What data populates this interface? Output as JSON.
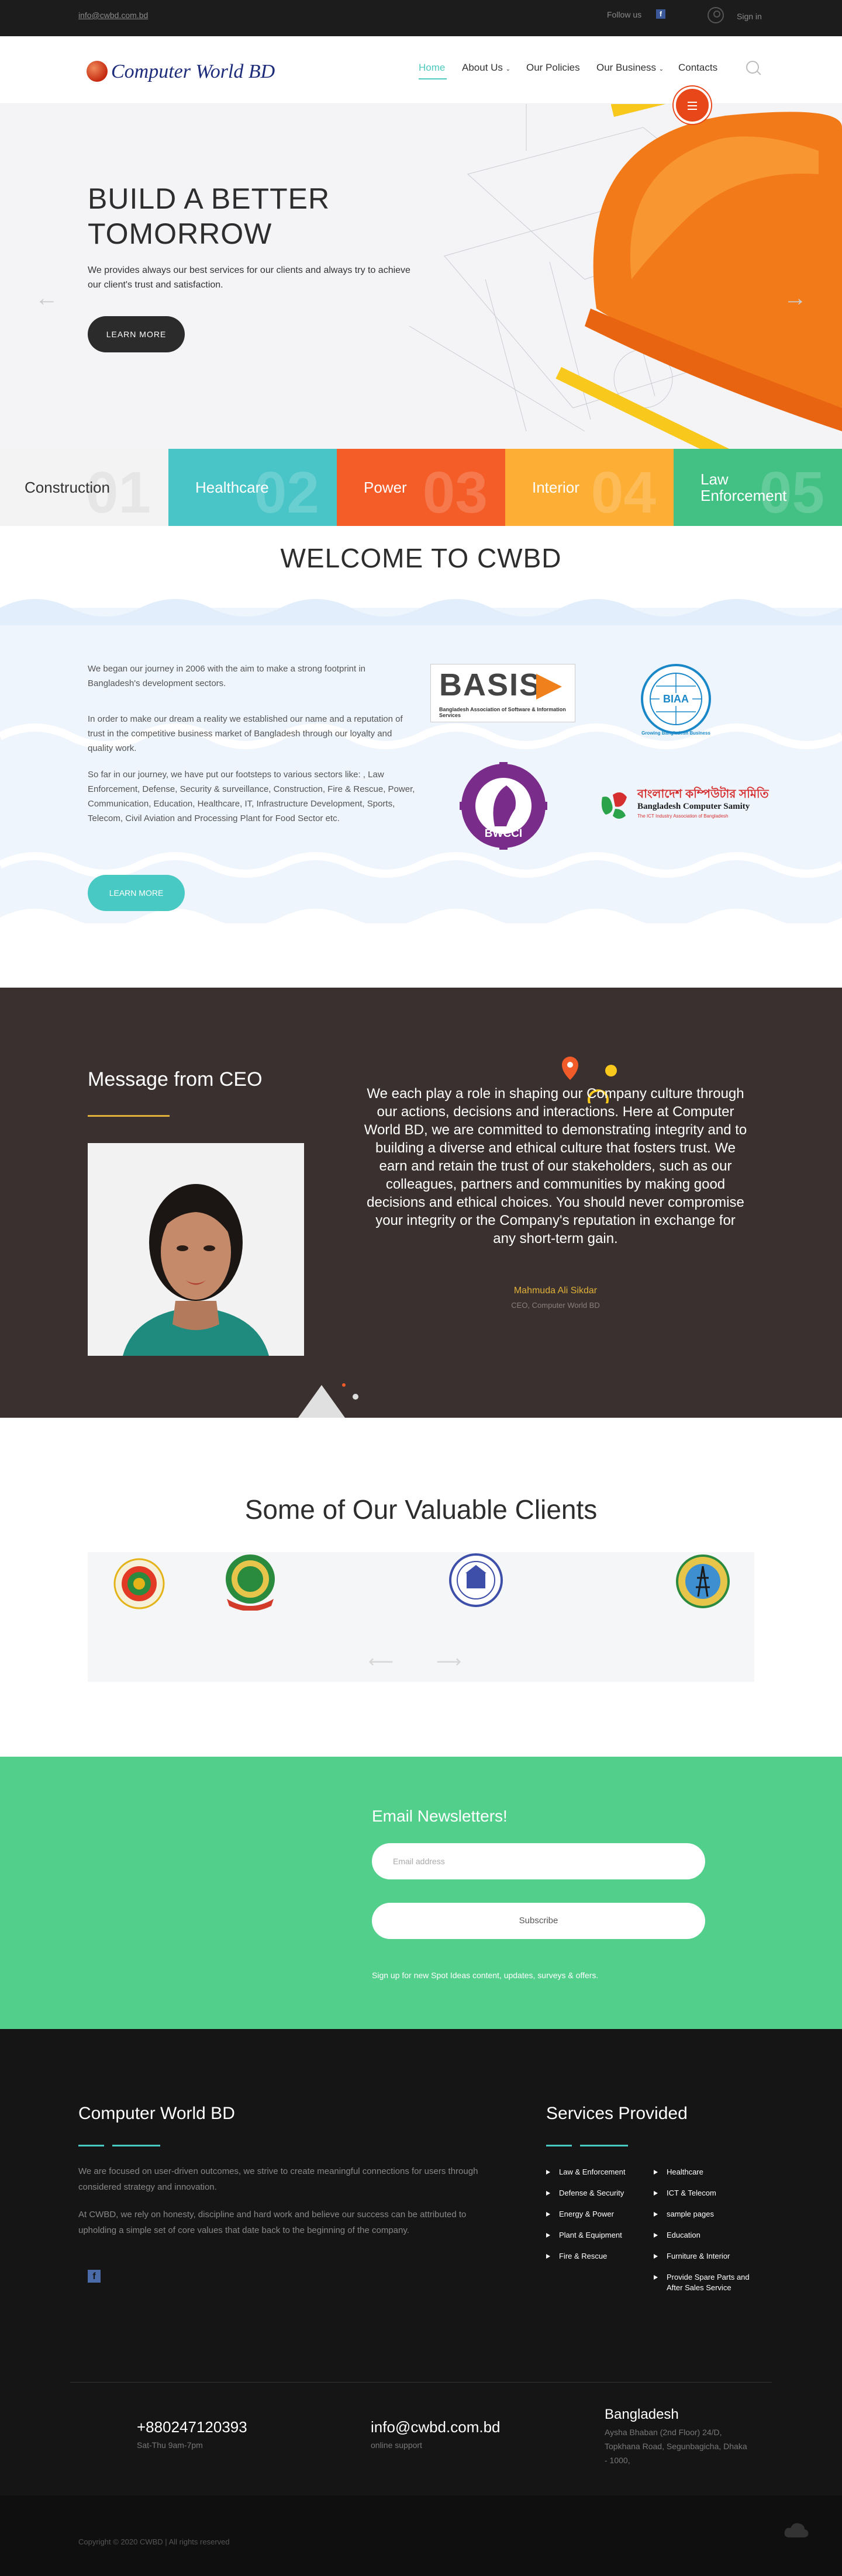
{
  "topbar": {
    "email": "info@cwbd.com.bd",
    "follow_label": "Follow us",
    "facebook_icon": "facebook-icon",
    "signin": "Sign in"
  },
  "header": {
    "logo_text": "Computer World BD",
    "nav": [
      {
        "label": "Home"
      },
      {
        "label": "About Us"
      },
      {
        "label": "Our Policies"
      },
      {
        "label": "Our Business"
      },
      {
        "label": "Contacts"
      }
    ]
  },
  "hero": {
    "heading": "BUILD A BETTER TOMORROW",
    "subtitle": "We provides always our best services for our clients and always try to achieve our client's trust and satisfaction.",
    "cta": "LEARN MORE"
  },
  "tabs": [
    {
      "label": "Construction",
      "num": "01",
      "color": "#f3f3f3"
    },
    {
      "label": "Healthcare",
      "num": "02",
      "color": "#49c5c7"
    },
    {
      "label": "Power",
      "num": "03",
      "color": "#f45c28"
    },
    {
      "label": "Interior",
      "num": "04",
      "color": "#fdae34"
    },
    {
      "label": "Law Enforcement",
      "num": "05",
      "color": "#43c184"
    }
  ],
  "welcome": {
    "title": "WELCOME TO CWBD",
    "p1": "We began our journey in 2006 with the aim to make a strong footprint in Bangladesh's development sectors.",
    "p2": "In order to make our dream a reality we established our name and a reputation of trust in the competitive business market of Bangladesh through our loyalty and quality work.",
    "p3": "So far in our journey, we have put our footsteps to various sectors like: , Law Enforcement, Defense, Security & surveillance, Construction, Fire & Rescue, Power, Communication, Education, Healthcare, IT, Infrastructure Development, Sports, Telecom, Civil Aviation and Processing Plant for Food Sector etc.",
    "cta": "LEARN MORE",
    "badges": {
      "basis_title": "BASIS",
      "basis_sub": "Bangladesh Association of Software & Information Services",
      "biaa": "BIAA",
      "biaa_sub": "Growing Bangladesh Business",
      "bwcci": "BWCCI",
      "bcs_bn": "বাংলাদেশ কম্পিউটার সমিতি",
      "bcs_en": "Bangladesh Computer Samity",
      "bcs_tag": "The ICT Industry Association of Bangladesh"
    }
  },
  "ceo": {
    "title": "Message from CEO",
    "message": "We each play a role in shaping our Company culture through our actions, decisions and interactions. Here at Computer World BD, we are committed to demonstrating integrity and to building a diverse and ethical culture that fosters trust. We earn and retain the trust of our stakeholders, such as our colleagues, partners and communities by making good decisions and ethical choices. You should never compromise your integrity or the Company's reputation in exchange for any short-term gain.",
    "name": "Mahmuda Ali Sikdar",
    "role": "CEO, Computer World BD"
  },
  "clients": {
    "title": "Some of Our Valuable Clients"
  },
  "newsletter": {
    "title": "Email Newsletters!",
    "placeholder": "Email address",
    "button": "Subscribe",
    "note": "Sign up for new Spot Ideas content, updates, surveys & offers."
  },
  "footer": {
    "company_title": "Computer World BD",
    "p1": "We are focused on user-driven outcomes, we strive to create meaningful connections for users through considered strategy and innovation.",
    "p2": "At CWBD, we rely on honesty, discipline and hard work and believe our success can be attributed to upholding a simple set of core values that date back to the beginning of the company.",
    "services_title": "Services Provided",
    "services_left": [
      "Law & Enforcement",
      "Defense & Security",
      "Energy & Power",
      "Plant & Equipment",
      "Fire & Rescue"
    ],
    "services_right": [
      "Healthcare",
      "ICT & Telecom",
      "sample pages",
      "Education",
      "Furniture & Interior",
      "Provide Spare Parts and After Sales Service"
    ],
    "phone": "+880247120393",
    "hours": "Sat-Thu 9am-7pm",
    "email": "info@cwbd.com.bd",
    "support": "online support",
    "country": "Bangladesh",
    "address": "Aysha Bhaban (2nd Floor) 24/D, Topkhana Road, Segunbagicha, Dhaka - 1000,",
    "copyright": "Copyright © 2020 CWBD | All rights reserved"
  }
}
